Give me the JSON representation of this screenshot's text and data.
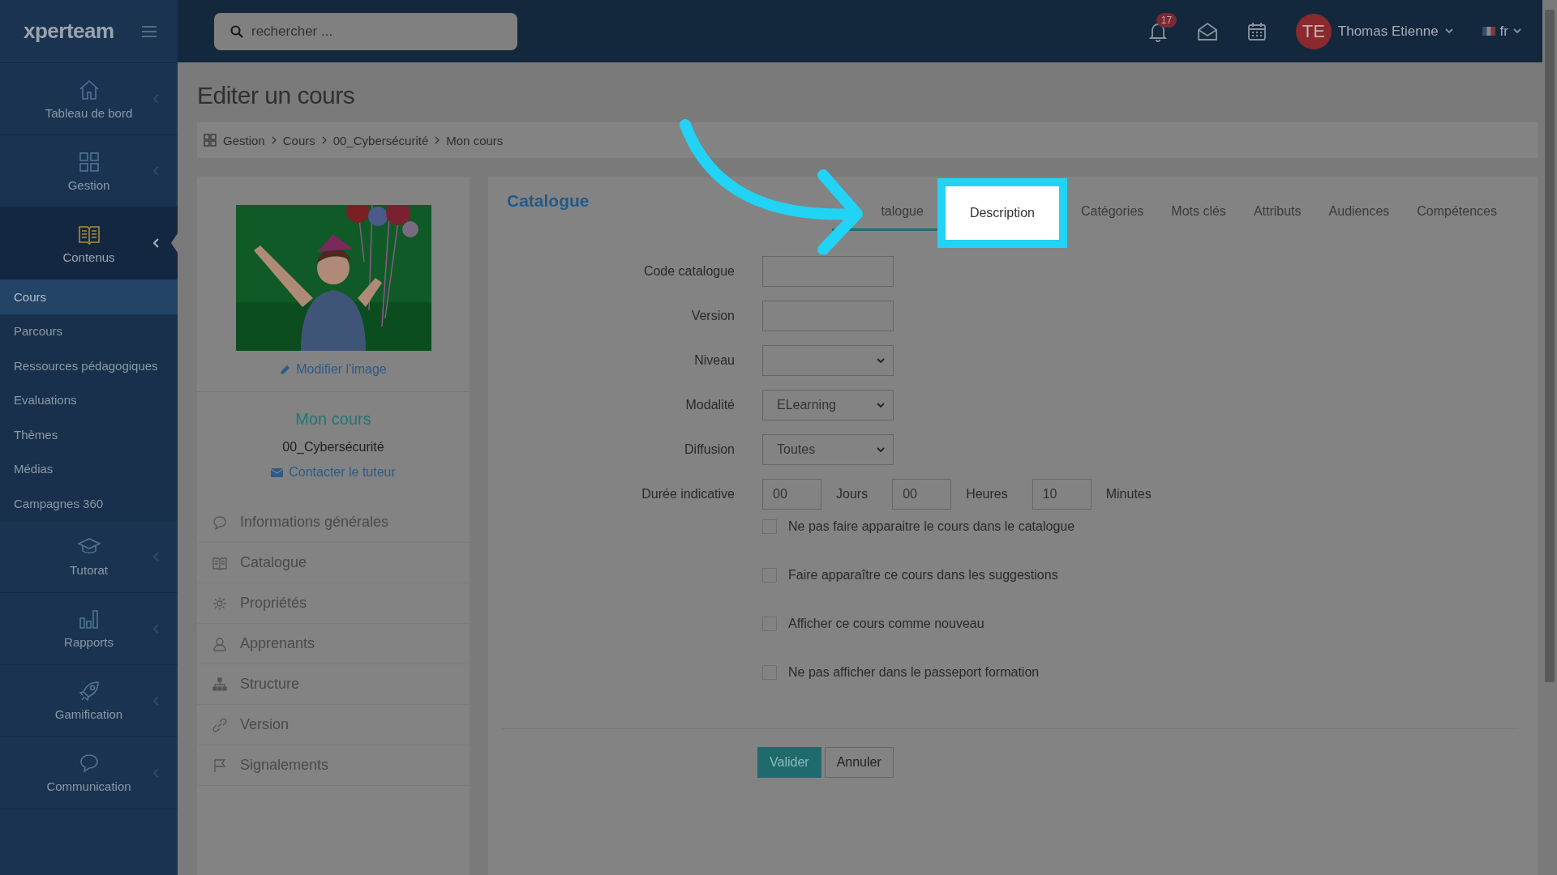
{
  "topbar": {
    "logo": "xperteam",
    "search": {
      "placeholder": "rechercher ..."
    },
    "notifications": {
      "count": "17"
    },
    "user": {
      "initials": "TE",
      "name": "Thomas Etienne"
    },
    "language": "fr"
  },
  "sidebar": {
    "items": [
      {
        "label": "Tableau de bord",
        "selected": false,
        "expanded": false
      },
      {
        "label": "Gestion",
        "selected": false,
        "expanded": false
      },
      {
        "label": "Contenus",
        "selected": true,
        "expanded": true,
        "children": [
          {
            "label": "Cours",
            "selected": true
          },
          {
            "label": "Parcours",
            "selected": false
          },
          {
            "label": "Ressources pédagogiques",
            "selected": false
          },
          {
            "label": "Evaluations",
            "selected": false
          },
          {
            "label": "Thèmes",
            "selected": false
          },
          {
            "label": "Médias",
            "selected": false
          },
          {
            "label": "Campagnes 360",
            "selected": false
          }
        ]
      },
      {
        "label": "Tutorat",
        "selected": false,
        "expanded": false
      },
      {
        "label": "Rapports",
        "selected": false,
        "expanded": false
      },
      {
        "label": "Gamification",
        "selected": false,
        "expanded": false
      },
      {
        "label": "Communication",
        "selected": false,
        "expanded": false
      }
    ]
  },
  "page": {
    "title": "Editer un cours",
    "breadcrumb": [
      "Gestion",
      "Cours",
      "00_Cybersécurité",
      "Mon cours"
    ]
  },
  "course_card": {
    "edit_image_link": "Modifier l'image",
    "title": "Mon cours",
    "category": "00_Cybersécurité",
    "contact_link": "Contacter le tuteur",
    "menu": [
      "Informations générales",
      "Catalogue",
      "Propriétés",
      "Apprenants",
      "Structure",
      "Version",
      "Signalements"
    ]
  },
  "form": {
    "title": "Catalogue",
    "tabs": [
      {
        "label": "talogue",
        "selected": true,
        "highlighted": false
      },
      {
        "label": "Description",
        "selected": false,
        "highlighted": true
      },
      {
        "label": "Catégories",
        "selected": false,
        "highlighted": false
      },
      {
        "label": "Mots clés",
        "selected": false,
        "highlighted": false
      },
      {
        "label": "Attributs",
        "selected": false,
        "highlighted": false
      },
      {
        "label": "Audiences",
        "selected": false,
        "highlighted": false
      },
      {
        "label": "Compétences",
        "selected": false,
        "highlighted": false
      }
    ],
    "fields": [
      {
        "kind": "text",
        "label": "Code catalogue"
      },
      {
        "kind": "text",
        "label": "Version"
      },
      {
        "kind": "select",
        "label": "Niveau"
      },
      {
        "kind": "select",
        "label": "Modalité",
        "value": "ELearning"
      },
      {
        "kind": "select",
        "label": "Diffusion",
        "value": "Toutes"
      },
      {
        "kind": "duration",
        "label": "Durée indicative",
        "parts": [
          {
            "value": "00",
            "unit": "Jours"
          },
          {
            "value": "00",
            "unit": "Heures"
          },
          {
            "value": "10",
            "unit": "Minutes"
          }
        ]
      }
    ],
    "checkboxes": [
      {
        "label": "Ne pas faire apparaitre le cours dans le catalogue",
        "checked": false
      },
      {
        "label": "Faire apparaître ce cours dans les suggestions",
        "checked": false
      },
      {
        "label": "Afficher ce cours comme nouveau",
        "checked": false
      },
      {
        "label": "Ne pas afficher dans le passeport formation",
        "checked": false
      }
    ],
    "buttons": [
      {
        "label": "Valider",
        "kind": "primary"
      },
      {
        "label": "Annuler",
        "kind": "secondary"
      }
    ]
  }
}
